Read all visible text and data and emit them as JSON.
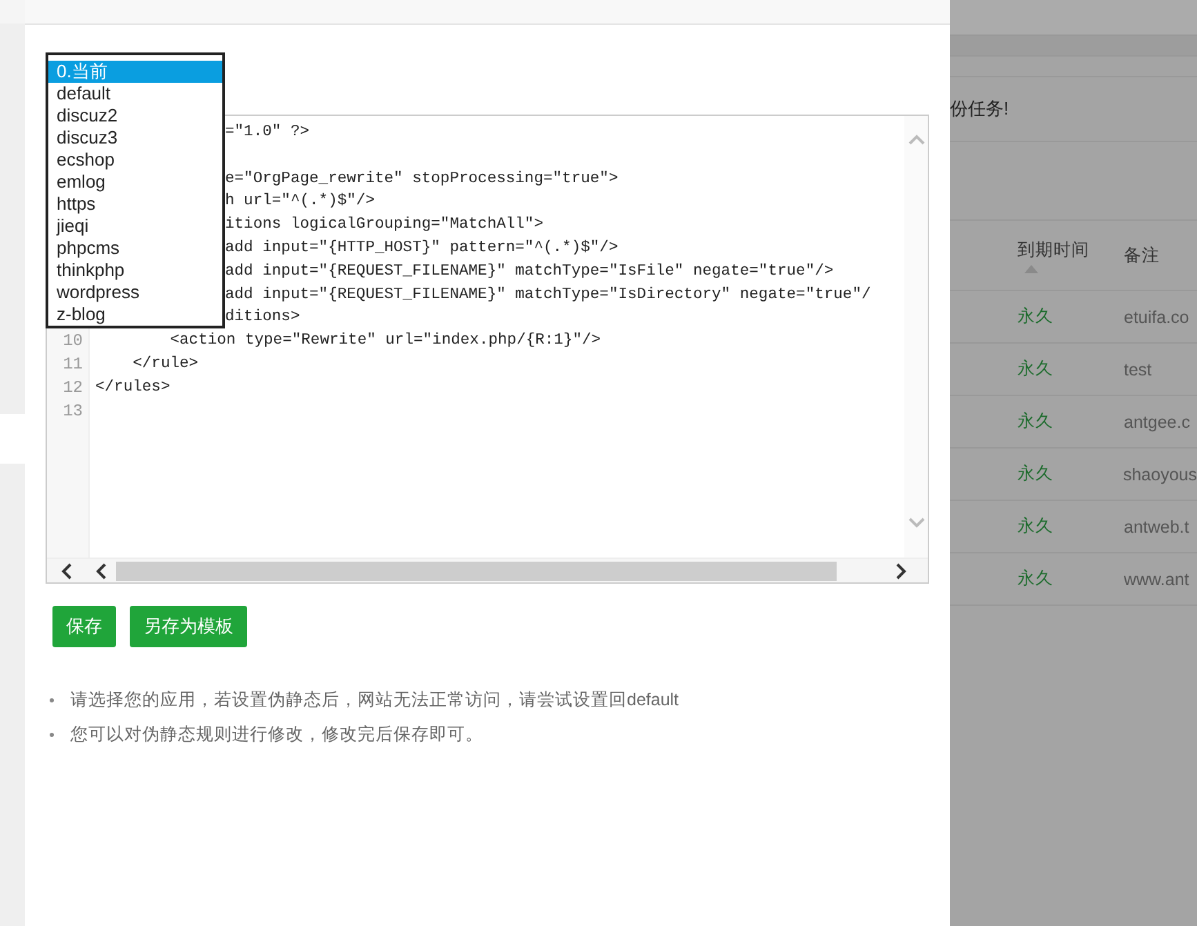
{
  "dialog": {
    "template_select": {
      "options": [
        {
          "label": "0.当前",
          "selected": true
        },
        {
          "label": "default",
          "selected": false
        },
        {
          "label": "discuz2",
          "selected": false
        },
        {
          "label": "discuz3",
          "selected": false
        },
        {
          "label": "ecshop",
          "selected": false
        },
        {
          "label": "emlog",
          "selected": false
        },
        {
          "label": "https",
          "selected": false
        },
        {
          "label": "jieqi",
          "selected": false
        },
        {
          "label": "phpcms",
          "selected": false
        },
        {
          "label": "thinkphp",
          "selected": false
        },
        {
          "label": "wordpress",
          "selected": false
        },
        {
          "label": "z-blog",
          "selected": false
        }
      ]
    },
    "editor": {
      "lines": [
        {
          "kind": "partial",
          "text": "=\"1.0\" ?>"
        },
        {
          "kind": "hidden"
        },
        {
          "kind": "partial",
          "text": "e=\"OrgPage_rewrite\" stopProcessing=\"true\">"
        },
        {
          "kind": "partial",
          "text": "h url=\"^(.*)$\"/>"
        },
        {
          "kind": "partial",
          "text": "itions logicalGrouping=\"MatchAll\">"
        },
        {
          "kind": "partial",
          "text": "add input=\"{HTTP_HOST}\" pattern=\"^(.*)$\"/>"
        },
        {
          "kind": "partial",
          "text": "add input=\"{REQUEST_FILENAME}\" matchType=\"IsFile\" negate=\"true\"/>"
        },
        {
          "kind": "partial",
          "text": "add input=\"{REQUEST_FILENAME}\" matchType=\"IsDirectory\" negate=\"true\"/"
        },
        {
          "kind": "partial",
          "text": "ditions>"
        },
        {
          "kind": "full",
          "number": "10",
          "text": "        <action type=\"Rewrite\" url=\"index.php/{R:1}\"/>"
        },
        {
          "kind": "full",
          "number": "11",
          "text": "    </rule>"
        },
        {
          "kind": "full",
          "number": "12",
          "text": "</rules>"
        },
        {
          "kind": "full",
          "number": "13"
        }
      ]
    },
    "buttons": [
      {
        "label": "保存"
      },
      {
        "label": "另存为模板"
      }
    ],
    "notes": [
      "请选择您的应用，若设置伪静态后，网站无法正常访问，请尝试设置回default",
      "您可以对伪静态规则进行修改，修改完后保存即可。"
    ]
  },
  "background_page": {
    "notice": "份任务!",
    "table": {
      "columns": [
        {
          "label": "到期时间",
          "sorted": true
        },
        {
          "label": "备注",
          "sorted": false
        }
      ],
      "rows": [
        {
          "expiry": "永久",
          "remark": "etuifa.co"
        },
        {
          "expiry": "永久",
          "remark": "test"
        },
        {
          "expiry": "永久",
          "remark": "antgee.c"
        },
        {
          "expiry": "永久",
          "remark": "shaoyous"
        },
        {
          "expiry": "永久",
          "remark": "antweb.t"
        },
        {
          "expiry": "永久",
          "remark": "www.ant"
        }
      ]
    }
  }
}
